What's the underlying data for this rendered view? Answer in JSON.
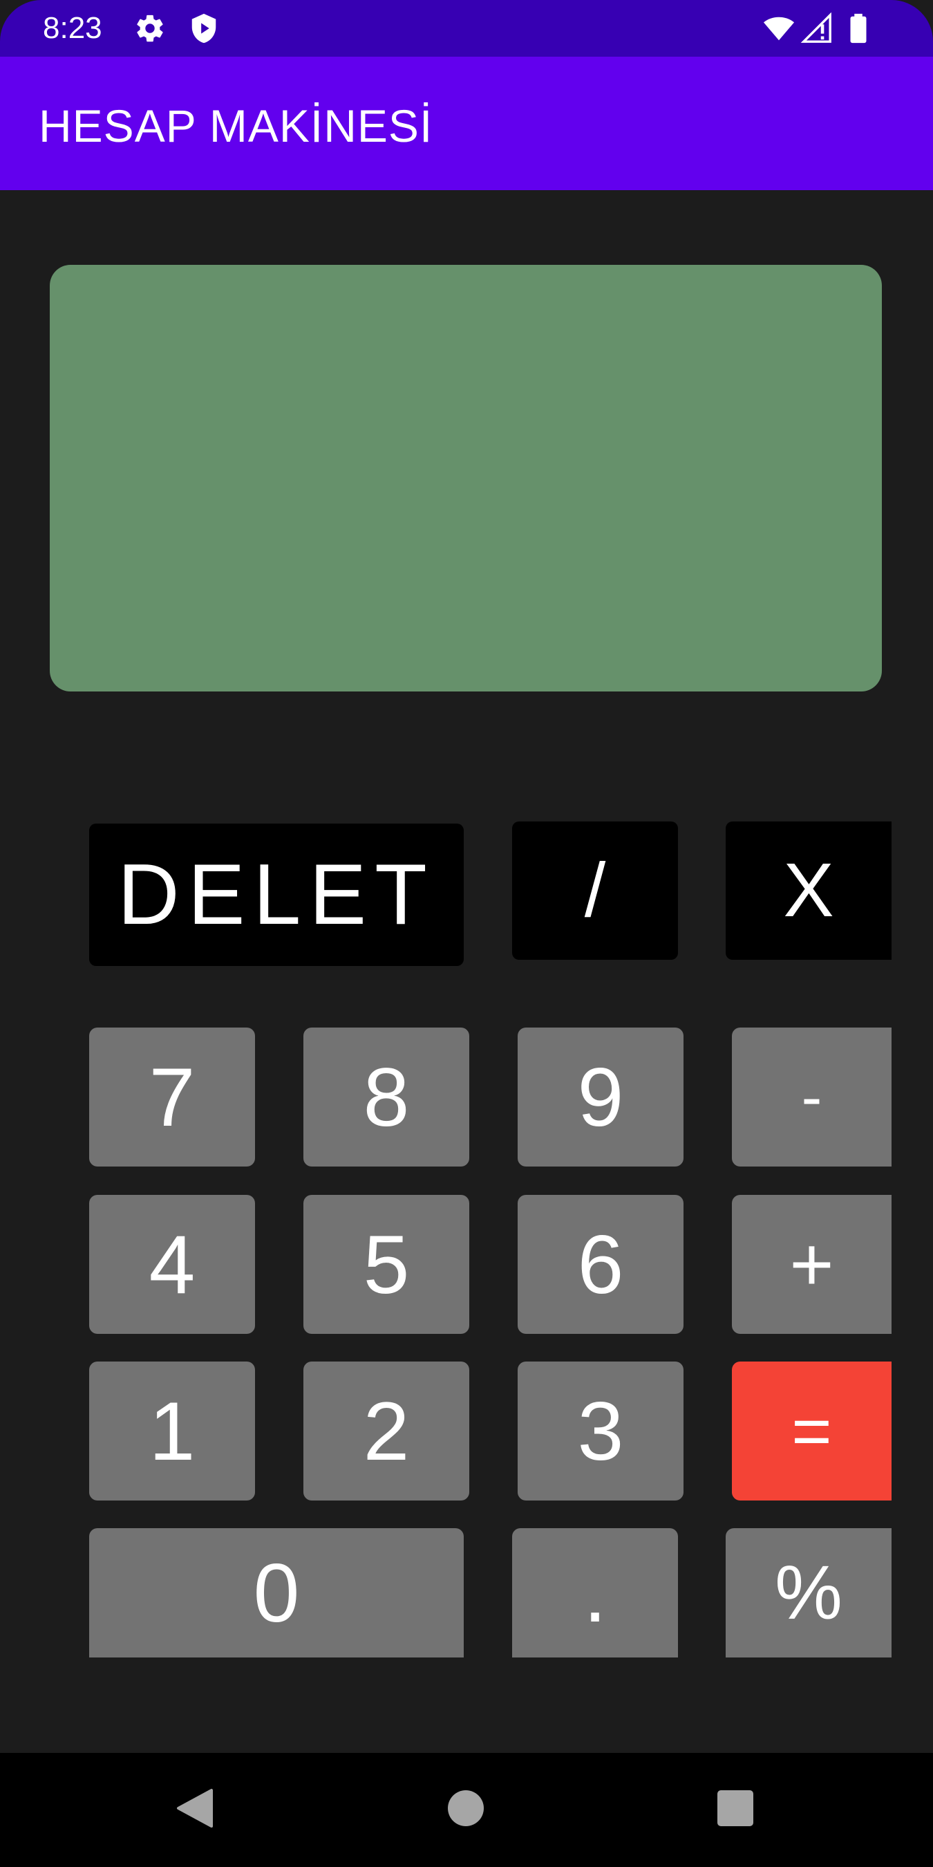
{
  "status_bar": {
    "time": "8:23",
    "icons": [
      "gear-icon",
      "shield-play-icon",
      "wifi-icon",
      "signal-icon",
      "battery-icon"
    ]
  },
  "app_bar": {
    "title": "HESAP MAKİNESİ"
  },
  "display": {
    "value": "",
    "color": "#66916b"
  },
  "keypad": {
    "delete": "DELET",
    "divide": "/",
    "multiply": "X",
    "seven": "7",
    "eight": "8",
    "nine": "9",
    "minus": "-",
    "four": "4",
    "five": "5",
    "six": "6",
    "plus": "+",
    "one": "1",
    "two": "2",
    "three": "3",
    "equals": "=",
    "zero": "0",
    "dot": ".",
    "percent": "%"
  },
  "colors": {
    "status_bar": "#3700b3",
    "app_bar": "#6200ee",
    "background": "#1c1c1c",
    "operator_key": "#000000",
    "number_key": "#737373",
    "equals_key": "#f44336"
  },
  "nav_bar": {
    "icons": [
      "back-icon",
      "home-icon",
      "recents-icon"
    ]
  }
}
